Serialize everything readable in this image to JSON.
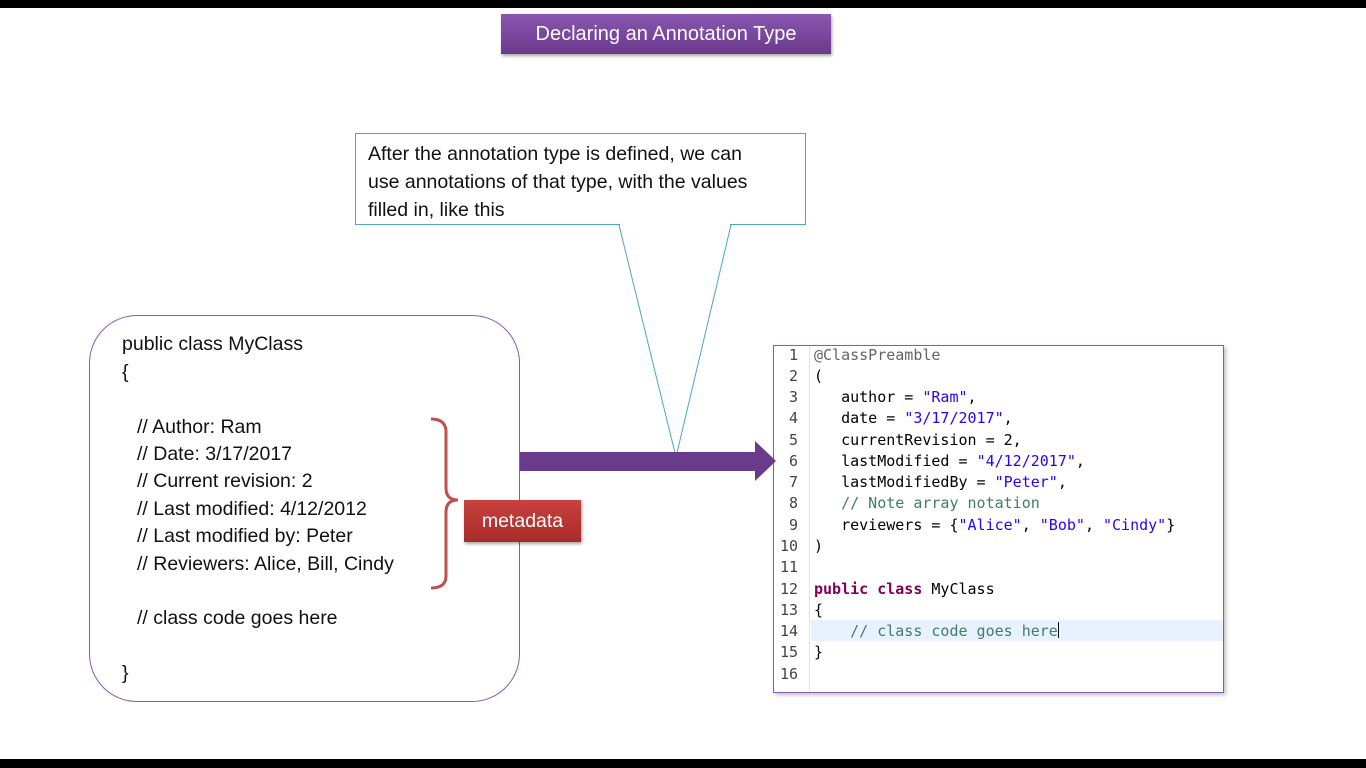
{
  "title": "Declaring an Annotation Type",
  "callout": {
    "lines": [
      "After the annotation type is defined, we can",
      "use annotations of that type, with the values",
      "filled in, like this"
    ]
  },
  "left_code": {
    "lines": [
      "public class MyClass",
      "{",
      "// Author: Ram",
      "// Date: 3/17/2017",
      "// Current revision: 2",
      "// Last modified: 4/12/2012",
      "// Last modified by: Peter",
      "// Reviewers: Alice, Bill, Cindy",
      "// class code goes here",
      "}"
    ]
  },
  "metadata_label": "metadata",
  "editor": {
    "line_numbers": [
      "1",
      "2",
      "3",
      "4",
      "5",
      "6",
      "7",
      "8",
      "9",
      "10",
      "11",
      "12",
      "13",
      "14",
      "15",
      "16"
    ],
    "code": {
      "l1": "@ClassPreamble",
      "l2": "(",
      "l3_key": "   author = ",
      "l3_val": "\"Ram\"",
      "l3_end": ",",
      "l4_key": "   date = ",
      "l4_val": "\"3/17/2017\"",
      "l4_end": ",",
      "l5": "   currentRevision = 2,",
      "l6_key": "   lastModified = ",
      "l6_val": "\"4/12/2017\"",
      "l6_end": ",",
      "l7_key": "   lastModifiedBy = ",
      "l7_val": "\"Peter\"",
      "l7_end": ",",
      "l8": "   // Note array notation",
      "l9_key": "   reviewers = {",
      "l9_v1": "\"Alice\"",
      "l9_sep1": ", ",
      "l9_v2": "\"Bob\"",
      "l9_sep2": ", ",
      "l9_v3": "\"Cindy\"",
      "l9_end": "}",
      "l10": ")",
      "l12_kw1": "public",
      "l12_kw2": "class",
      "l12_name": " MyClass",
      "l13": "{",
      "l14": "    // class code goes here",
      "l15": "}"
    }
  },
  "colors": {
    "title_bg": "#7b4a9e",
    "metadata_bg": "#b83634",
    "bracket": "#c0504d",
    "arrow": "#6a3a8c",
    "callout_border": "#4aa8c0"
  }
}
